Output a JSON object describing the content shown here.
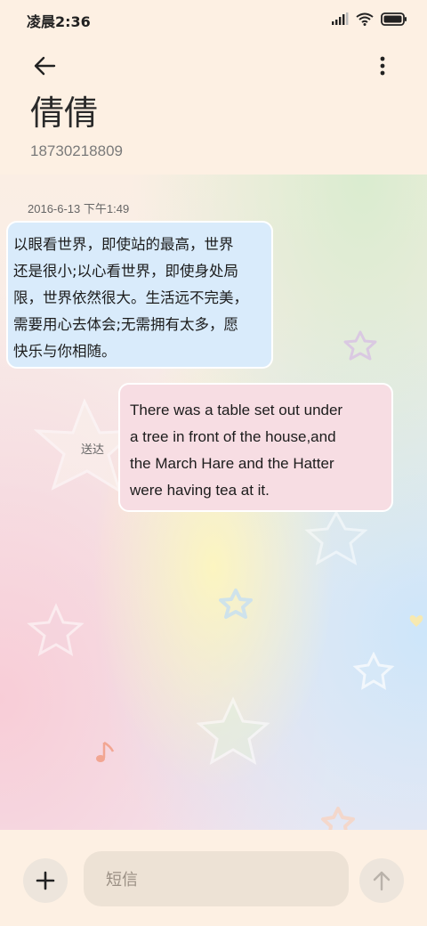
{
  "status_bar": {
    "time": "凌晨2:36",
    "icons": [
      "signal-icon",
      "wifi-icon",
      "battery-icon"
    ]
  },
  "header": {
    "back_icon": "arrow-left-icon",
    "more_icon": "more-vertical-icon",
    "contact_name": "倩倩",
    "contact_number": "18730218809"
  },
  "thread": {
    "timestamp": "2016-6-13 下午1:49",
    "messages": [
      {
        "direction": "incoming",
        "lines": [
          "以眼看世界，即使站的最高，世界",
          "还是很小;以心看世界，即使身处局",
          "限，世界依然很大。生活远不完美，",
          "需要用心去体会;无需拥有太多，愿",
          "快乐与你相随。"
        ]
      },
      {
        "direction": "outgoing",
        "lines": [
          "There was a table set out under",
          "a tree in front of the house,and",
          "the March Hare and the Hatter",
          "were having tea at it."
        ],
        "status": "送达"
      }
    ]
  },
  "composer": {
    "add_icon": "plus-icon",
    "placeholder": "短信",
    "send_icon": "arrow-up-icon"
  },
  "colors": {
    "background": "#fdf0e3",
    "incoming_bubble": "#d9ebfb",
    "outgoing_bubble": "#f7dde3"
  }
}
